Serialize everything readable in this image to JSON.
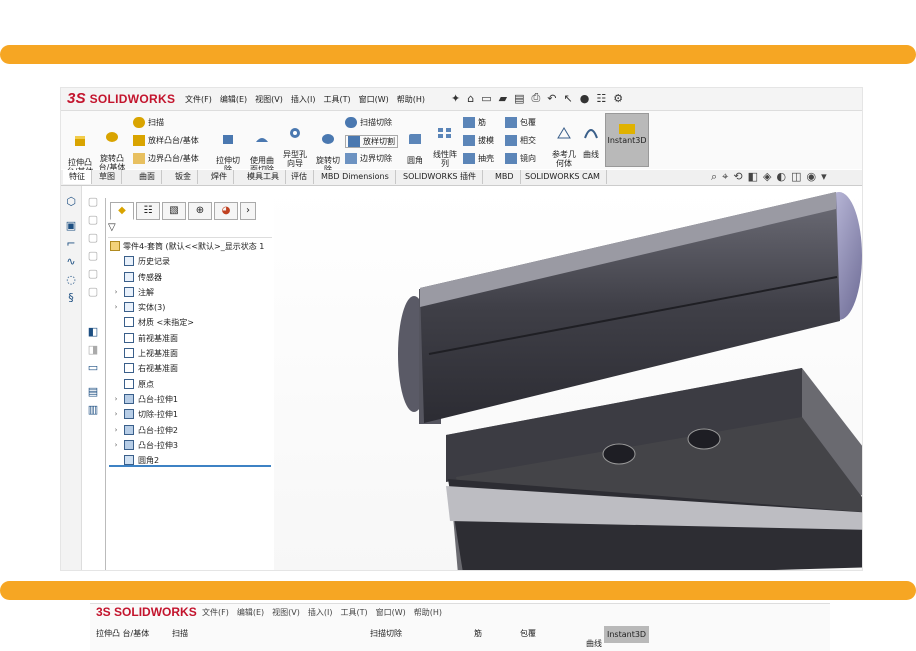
{
  "app": {
    "logo": "SOLIDWORKS",
    "logo_mark": "3S",
    "menus": [
      "文件(F)",
      "编辑(E)",
      "视图(V)",
      "插入(I)",
      "工具(T)",
      "窗口(W)",
      "帮助(H)"
    ]
  },
  "ribbon": {
    "large": [
      "拉伸凸\n台/基体",
      "旋转凸\n台/基体",
      "拉伸切\n除",
      "使用曲\n面切除",
      "异型孔\n向导",
      "旋转切\n除",
      "圆角",
      "线性阵\n列",
      "参考几\n何体",
      "曲线"
    ],
    "small": [
      "扫描",
      "放样凸台/基体",
      "边界凸台/基体",
      "扫描切除",
      "放样切割",
      "边界切除",
      "筋",
      "拔模",
      "抽壳",
      "包覆",
      "相交",
      "镜向"
    ],
    "instant3d": "Instant3D"
  },
  "tabs": [
    "特征",
    "草图",
    "曲面",
    "钣金",
    "焊件",
    "模具工具",
    "评估",
    "MBD Dimensions",
    "SOLIDWORKS 插件",
    "MBD",
    "SOLIDWORKS CAM"
  ],
  "tree": {
    "root": "零件4-套筒  (默认<<默认>_显示状态 1",
    "items": [
      {
        "label": "历史记录",
        "arrow": false
      },
      {
        "label": "传感器",
        "arrow": false
      },
      {
        "label": "注解",
        "arrow": true
      },
      {
        "label": "实体(3)",
        "arrow": true
      },
      {
        "label": "材质 <未指定>",
        "arrow": false
      },
      {
        "label": "前视基准面",
        "arrow": false
      },
      {
        "label": "上视基准面",
        "arrow": false
      },
      {
        "label": "右视基准面",
        "arrow": false
      },
      {
        "label": "原点",
        "arrow": false
      },
      {
        "label": "凸台-拉伸1",
        "arrow": true
      },
      {
        "label": "切除-拉伸1",
        "arrow": true
      },
      {
        "label": "凸台-拉伸2",
        "arrow": true
      },
      {
        "label": "凸台-拉伸3",
        "arrow": true
      },
      {
        "label": "圆角2",
        "arrow": false
      }
    ]
  },
  "colors": {
    "accent_bar": "#f6a623",
    "logo_red": "#c3142d",
    "selection_blue": "#3d82c4"
  }
}
